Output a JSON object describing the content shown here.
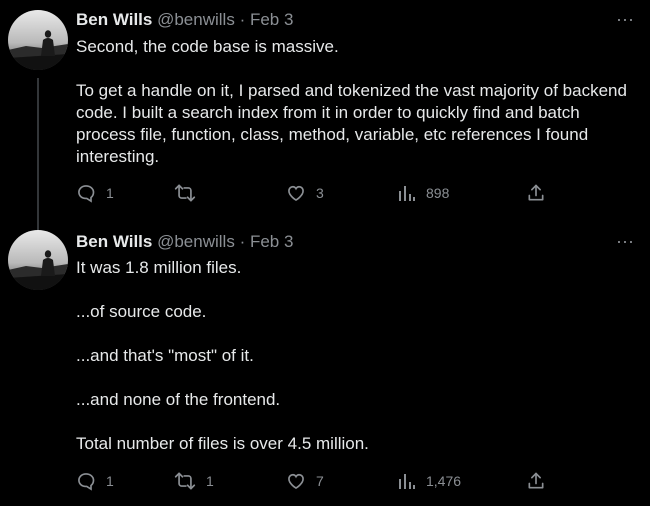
{
  "tweets": [
    {
      "author_name": "Ben Wills",
      "handle": "@benwills",
      "separator": "·",
      "date": "Feb 3",
      "paragraphs": [
        "Second, the code base is massive.",
        "To get a handle on it, I parsed and tokenized the vast majority of backend code. I built a search index from it in order to quickly find and batch process file, function, class, method, variable, etc references I found interesting."
      ],
      "stats": {
        "replies": "1",
        "retweets": "",
        "likes": "3",
        "views": "898"
      },
      "more_label": "···"
    },
    {
      "author_name": "Ben Wills",
      "handle": "@benwills",
      "separator": "·",
      "date": "Feb 3",
      "paragraphs": [
        "It was 1.8 million files.",
        "...of source code.",
        "...and that's \"most\" of it.",
        "...and none of the frontend.",
        "Total number of files is over 4.5 million."
      ],
      "stats": {
        "replies": "1",
        "retweets": "1",
        "likes": "7",
        "views": "1,476"
      },
      "more_label": "···"
    }
  ],
  "icons": {
    "reply": "reply-icon",
    "retweet": "retweet-icon",
    "like": "heart-icon",
    "views": "views-chart-icon",
    "share": "share-icon",
    "more": "more-dots-icon"
  },
  "colors": {
    "background": "#000000",
    "text_primary": "#e7e9ea",
    "text_secondary": "#8b8f94",
    "thread_line": "#333639"
  }
}
